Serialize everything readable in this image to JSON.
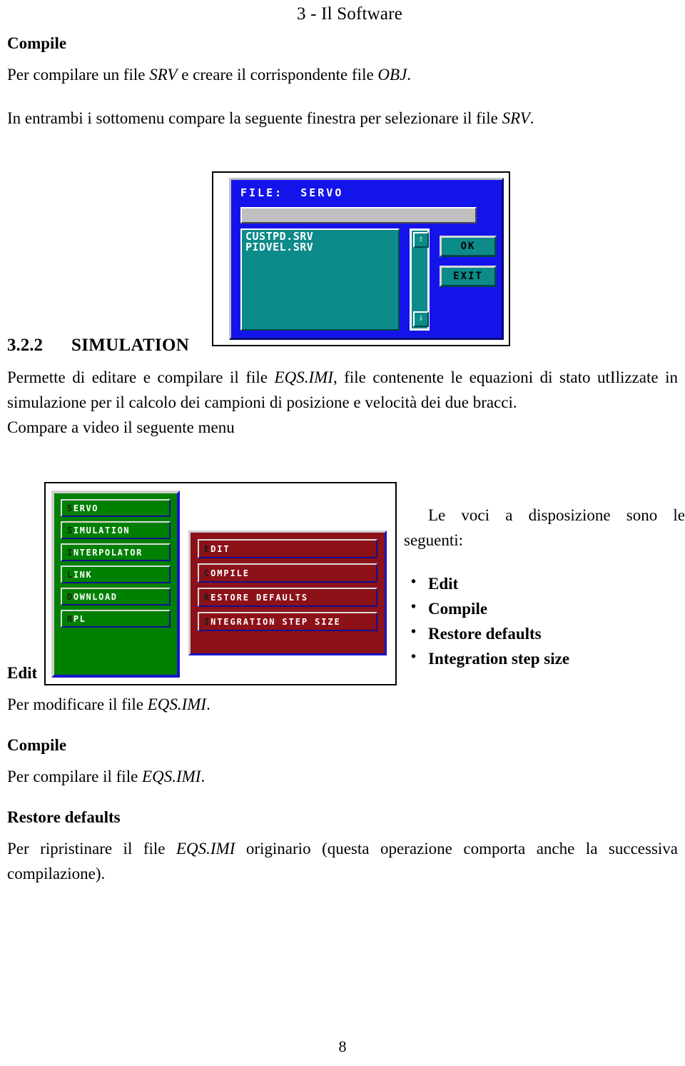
{
  "document": {
    "running_head": "3 - Il Software",
    "page_number": "8"
  },
  "section_compile": {
    "heading": "Compile",
    "line1_prefix": "Per compilare un file ",
    "line1_it1": "SRV",
    "line1_mid": " e creare il corrispondente file ",
    "line1_it2": "OBJ",
    "line1_suffix": ".",
    "line2_prefix": "In entrambi i sottomenu compare la seguente finestra per selezionare il file ",
    "line2_it": "SRV",
    "line2_suffix": "."
  },
  "file_dialog": {
    "title": "FILE:  SERVO",
    "input_value": "",
    "files": [
      "CUSTPD.SRV",
      "PIDVEL.SRV"
    ],
    "scroll_up_icon": "arrow-up-icon",
    "scroll_down_icon": "arrow-down-icon",
    "scroll_up_glyph": "⇧",
    "scroll_down_glyph": "⇩",
    "ok_label": "OK",
    "exit_label": "EXIT",
    "colors": {
      "dialog_bg": "#1414ea",
      "control_bg": "#0d8a8a",
      "input_bg": "#c0c0c0",
      "text": "#ffffff"
    }
  },
  "section_simulation": {
    "number": "3.2.2",
    "title": "SIMULATION",
    "body_p1_a": "Permette di editare e compilare il file ",
    "body_p1_it": "EQS.IMI",
    "body_p1_b": ", file contenente le equazioni di stato utIlizzate in simulazione per il calcolo dei campioni di posizione e velocità dei due bracci.",
    "body_p2": "Compare a video il seguente menu"
  },
  "simulation_menu": {
    "left_menu": {
      "items": [
        "SERVO",
        "SIMULATION",
        "INTERPOLATOR",
        "LINK",
        "DOWNLOAD",
        "RPL"
      ],
      "bg": "#008000"
    },
    "right_menu": {
      "items": [
        "EDIT",
        "COMPILE",
        "RESTORE DEFAULTS",
        "INTEGRATION STEP SIZE"
      ],
      "bg": "#8c1118"
    }
  },
  "voci": {
    "intro": "Le voci a disposizione sono le seguenti:",
    "items": [
      "Edit",
      "Compile",
      "Restore defaults",
      "Integration step size"
    ]
  },
  "entries": {
    "edit": {
      "heading": "Edit",
      "text_a": "Per modificare il file ",
      "text_it": "EQS.IMI",
      "text_b": "."
    },
    "compile": {
      "heading": "Compile",
      "text_a": "Per compilare il file ",
      "text_it": "EQS.IMI",
      "text_b": "."
    },
    "restore": {
      "heading": "Restore defaults",
      "text_a": "Per ripristinare il file ",
      "text_it": "EQS.IMI",
      "text_b": " originario (questa operazione comporta anche la successiva compilazione)."
    }
  }
}
